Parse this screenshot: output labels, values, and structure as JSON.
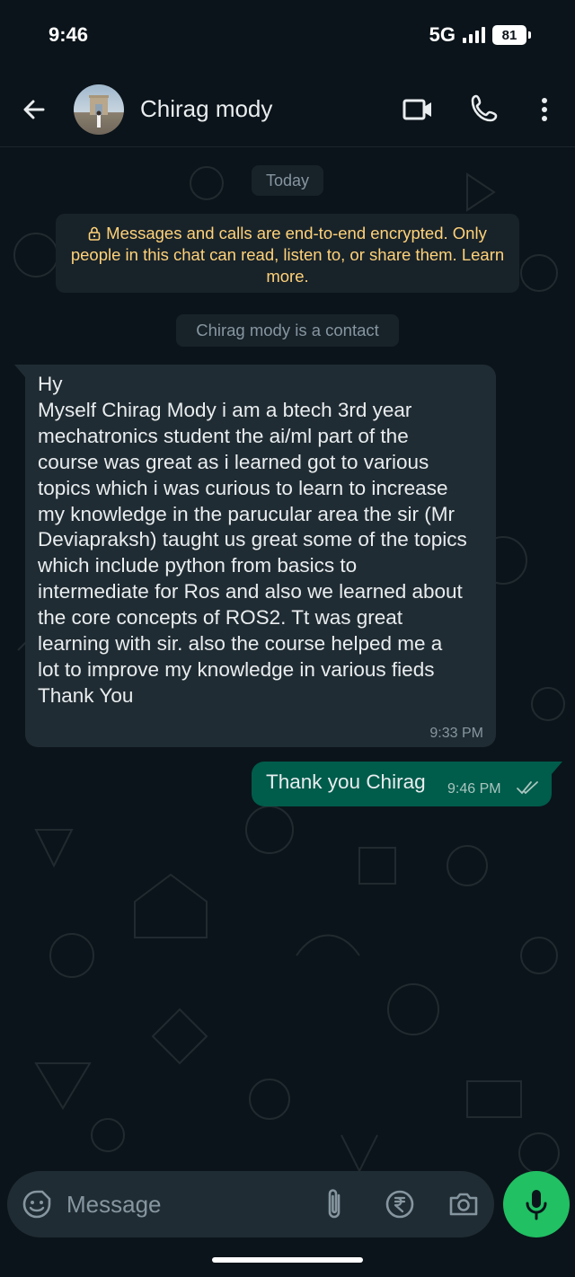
{
  "status_bar": {
    "time": "9:46",
    "network": "5G",
    "battery": "81"
  },
  "header": {
    "contact_name": "Chirag mody",
    "icons": [
      "back-arrow-icon",
      "video-call-icon",
      "phone-icon",
      "more-vertical-icon"
    ]
  },
  "chat": {
    "date_chip": "Today",
    "encryption_notice": "Messages and calls are end-to-end encrypted. Only people in this chat can read, listen to, or share them. Learn more.",
    "contact_notice": "Chirag mody is a contact",
    "messages": [
      {
        "direction": "incoming",
        "text": "Hy\nMyself Chirag Mody i am a btech 3rd year mechatronics student  the ai/ml part of the course was great as i learned got to various topics which i was curious to learn to increase my knowledge in the parucular area the sir (Mr Deviapraksh) taught us great some of the topics which include python from basics to intermediate for Ros and also we learned about the core concepts of ROS2. Tt was great learning with sir. also the course helped me a lot to improve my knowledge in various fieds\nThank You",
        "time": "9:33 PM"
      },
      {
        "direction": "outgoing",
        "text": "Thank you Chirag",
        "time": "9:46 PM",
        "status": "read"
      }
    ]
  },
  "composer": {
    "placeholder": "Message",
    "icons": [
      "emoji-sticker-icon",
      "attach-icon",
      "rupee-payment-icon",
      "camera-icon",
      "mic-icon"
    ]
  },
  "colors": {
    "background": "#0b141a",
    "incoming_bubble": "#202c33",
    "outgoing_bubble": "#005c4b",
    "accent_green": "#21c063",
    "encryption_text": "#ffd279"
  }
}
